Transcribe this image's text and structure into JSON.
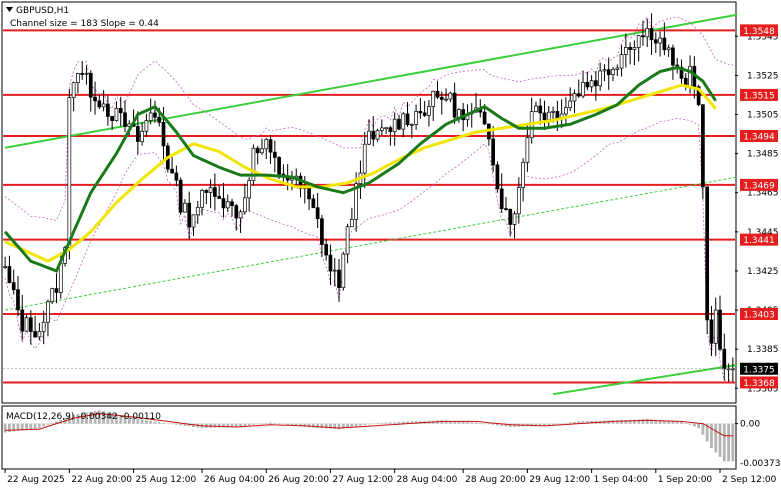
{
  "header": {
    "symbol": "GBPUSD,H1",
    "channel_info": "Channel size = 183  Slope = 0.44"
  },
  "macd": {
    "label": "MACD(12,26,9) -0.00342 -0.00110",
    "axis_labels": [
      "0.00",
      "-0.00373"
    ]
  },
  "colors": {
    "level_line": "#e41e1e",
    "level_box": "#e41e1e",
    "ma_fast": "#1a7a1a",
    "ma_slow": "#f2e600",
    "channel": "#3ccf3c",
    "bollinger": "#c860c8",
    "macd_signal": "#c41010",
    "macd_hist": "#b4b4b4"
  },
  "chart_data": {
    "type": "candlestick",
    "symbol": "GBPUSD",
    "timeframe": "H1",
    "ylim": [
      1.3358,
      1.3562
    ],
    "y_ticks": [
      1.3545,
      1.3525,
      1.3505,
      1.3485,
      1.3465,
      1.3445,
      1.3425,
      1.3405,
      1.3385,
      1.3365
    ],
    "x_ticks": [
      "22 Aug 2025",
      "22 Aug 20:00",
      "25 Aug 12:00",
      "26 Aug 04:00",
      "26 Aug 20:00",
      "27 Aug 12:00",
      "28 Aug 04:00",
      "28 Aug 20:00",
      "29 Aug 12:00",
      "1 Sep 04:00",
      "1 Sep 20:00",
      "2 Sep 12:00"
    ],
    "levels": [
      1.3548,
      1.3515,
      1.3494,
      1.3469,
      1.3441,
      1.3403,
      1.3368
    ],
    "current_price": 1.3375,
    "close_path": [
      [
        0,
        1.3425
      ],
      [
        4,
        1.3398
      ],
      [
        8,
        1.3395
      ],
      [
        12,
        1.3418
      ],
      [
        14,
        1.3435
      ],
      [
        15,
        1.3518
      ],
      [
        17,
        1.3528
      ],
      [
        20,
        1.3518
      ],
      [
        24,
        1.3508
      ],
      [
        28,
        1.35
      ],
      [
        31,
        1.3492
      ],
      [
        34,
        1.3505
      ],
      [
        36,
        1.3502
      ],
      [
        38,
        1.348
      ],
      [
        41,
        1.346
      ],
      [
        43,
        1.3452
      ],
      [
        46,
        1.3462
      ],
      [
        49,
        1.3468
      ],
      [
        52,
        1.3458
      ],
      [
        55,
        1.3455
      ],
      [
        58,
        1.3485
      ],
      [
        61,
        1.3488
      ],
      [
        64,
        1.3476
      ],
      [
        67,
        1.3472
      ],
      [
        70,
        1.3465
      ],
      [
        73,
        1.345
      ],
      [
        76,
        1.3425
      ],
      [
        78,
        1.342
      ],
      [
        81,
        1.3455
      ],
      [
        83,
        1.348
      ],
      [
        85,
        1.3492
      ],
      [
        88,
        1.3495
      ],
      [
        92,
        1.3502
      ],
      [
        96,
        1.3505
      ],
      [
        100,
        1.3512
      ],
      [
        103,
        1.3515
      ],
      [
        107,
        1.3502
      ],
      [
        110,
        1.3505
      ],
      [
        113,
        1.3495
      ],
      [
        116,
        1.346
      ],
      [
        118,
        1.3452
      ],
      [
        120,
        1.3465
      ],
      [
        123,
        1.351
      ],
      [
        127,
        1.3505
      ],
      [
        131,
        1.351
      ],
      [
        135,
        1.352
      ],
      [
        139,
        1.3525
      ],
      [
        142,
        1.353
      ],
      [
        145,
        1.354
      ],
      [
        148,
        1.3545
      ],
      [
        151,
        1.3548
      ],
      [
        154,
        1.354
      ],
      [
        156,
        1.3532
      ],
      [
        158,
        1.352
      ],
      [
        160,
        1.3525
      ],
      [
        162,
        1.351
      ],
      [
        163,
        1.3468
      ],
      [
        164,
        1.34
      ],
      [
        165,
        1.3388
      ],
      [
        166,
        1.3405
      ],
      [
        167,
        1.3385
      ],
      [
        168,
        1.3375
      ]
    ],
    "ma_fast": [
      [
        0,
        1.3445
      ],
      [
        6,
        1.343
      ],
      [
        12,
        1.3425
      ],
      [
        15,
        1.344
      ],
      [
        20,
        1.3465
      ],
      [
        26,
        1.3485
      ],
      [
        31,
        1.3505
      ],
      [
        35,
        1.3509
      ],
      [
        40,
        1.3496
      ],
      [
        44,
        1.3484
      ],
      [
        50,
        1.3478
      ],
      [
        55,
        1.3474
      ],
      [
        61,
        1.3474
      ],
      [
        67,
        1.3473
      ],
      [
        73,
        1.3468
      ],
      [
        79,
        1.3465
      ],
      [
        85,
        1.347
      ],
      [
        92,
        1.348
      ],
      [
        97,
        1.349
      ],
      [
        103,
        1.35
      ],
      [
        107,
        1.3504
      ],
      [
        112,
        1.3509
      ],
      [
        116,
        1.3503
      ],
      [
        120,
        1.3498
      ],
      [
        126,
        1.3498
      ],
      [
        132,
        1.35
      ],
      [
        138,
        1.3505
      ],
      [
        143,
        1.351
      ],
      [
        148,
        1.352
      ],
      [
        153,
        1.3527
      ],
      [
        157,
        1.3529
      ],
      [
        160,
        1.3527
      ],
      [
        163,
        1.3522
      ],
      [
        166,
        1.3512
      ]
    ],
    "ma_slow": [
      [
        0,
        1.344
      ],
      [
        5,
        1.3435
      ],
      [
        10,
        1.343
      ],
      [
        15,
        1.3436
      ],
      [
        20,
        1.3445
      ],
      [
        26,
        1.346
      ],
      [
        32,
        1.3472
      ],
      [
        38,
        1.3483
      ],
      [
        44,
        1.349
      ],
      [
        50,
        1.3486
      ],
      [
        56,
        1.3478
      ],
      [
        62,
        1.3472
      ],
      [
        68,
        1.3468
      ],
      [
        74,
        1.3468
      ],
      [
        80,
        1.347
      ],
      [
        86,
        1.3475
      ],
      [
        92,
        1.3482
      ],
      [
        98,
        1.3488
      ],
      [
        104,
        1.3492
      ],
      [
        110,
        1.3496
      ],
      [
        116,
        1.3498
      ],
      [
        122,
        1.35
      ],
      [
        128,
        1.3502
      ],
      [
        134,
        1.3505
      ],
      [
        140,
        1.3508
      ],
      [
        146,
        1.3512
      ],
      [
        152,
        1.3516
      ],
      [
        158,
        1.352
      ],
      [
        162,
        1.3518
      ],
      [
        166,
        1.3508
      ]
    ],
    "channel_upper": [
      [
        0,
        1.3488
      ],
      [
        171,
        1.3556
      ]
    ],
    "channel_lower": [
      [
        0,
        1.3405
      ],
      [
        171,
        1.3473
      ]
    ],
    "channel_low_green": [
      [
        128,
        1.3362
      ],
      [
        171,
        1.3377
      ]
    ],
    "macd_signal": [
      [
        0,
        -0.0006
      ],
      [
        8,
        -0.0005
      ],
      [
        16,
        0.0005
      ],
      [
        22,
        0.0009
      ],
      [
        30,
        0.0006
      ],
      [
        38,
        0.0002
      ],
      [
        46,
        -0.0002
      ],
      [
        54,
        -0.0003
      ],
      [
        62,
        -0.0001
      ],
      [
        70,
        -0.0002
      ],
      [
        78,
        -0.0004
      ],
      [
        86,
        -0.0002
      ],
      [
        94,
        0.0
      ],
      [
        102,
        0.0002
      ],
      [
        110,
        0.0002
      ],
      [
        118,
        -0.0001
      ],
      [
        126,
        -0.0002
      ],
      [
        134,
        0.0
      ],
      [
        142,
        0.0002
      ],
      [
        150,
        0.0003
      ],
      [
        158,
        0.0002
      ],
      [
        163,
        0.0
      ],
      [
        168,
        -0.0011
      ]
    ],
    "macd_hist": [
      [
        0,
        -0.0008
      ],
      [
        8,
        -0.0004
      ],
      [
        16,
        0.0008
      ],
      [
        22,
        0.0012
      ],
      [
        30,
        0.0005
      ],
      [
        38,
        0.0
      ],
      [
        46,
        -0.0004
      ],
      [
        54,
        -0.0003
      ],
      [
        62,
        0.0001
      ],
      [
        70,
        -0.0003
      ],
      [
        78,
        -0.0005
      ],
      [
        86,
        0.0
      ],
      [
        94,
        0.0002
      ],
      [
        102,
        0.0003
      ],
      [
        110,
        0.0001
      ],
      [
        118,
        -0.0003
      ],
      [
        126,
        -0.0002
      ],
      [
        134,
        0.0002
      ],
      [
        142,
        0.0003
      ],
      [
        150,
        0.0004
      ],
      [
        158,
        0.0002
      ],
      [
        162,
        -0.0004
      ],
      [
        165,
        -0.0022
      ],
      [
        168,
        -0.0034
      ]
    ]
  }
}
